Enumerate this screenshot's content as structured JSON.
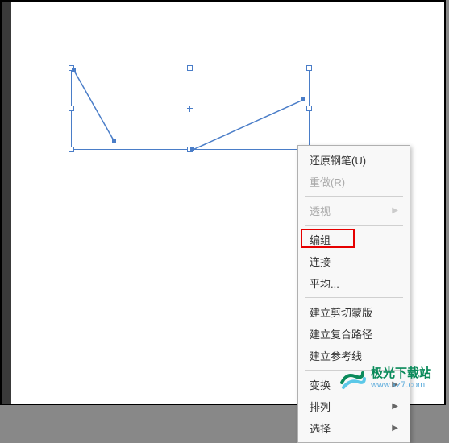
{
  "menu": {
    "undo_pen": "还原钢笔(U)",
    "redo": "重做(R)",
    "perspective": "透视",
    "group": "编组",
    "join": "连接",
    "average": "平均...",
    "make_clipping_mask": "建立剪切蒙版",
    "make_compound_path": "建立复合路径",
    "make_guides": "建立参考线",
    "transform": "变换",
    "arrange": "排列",
    "select": "选择"
  },
  "watermark": {
    "name": "极光下载站",
    "url": "www.xz7.com"
  }
}
